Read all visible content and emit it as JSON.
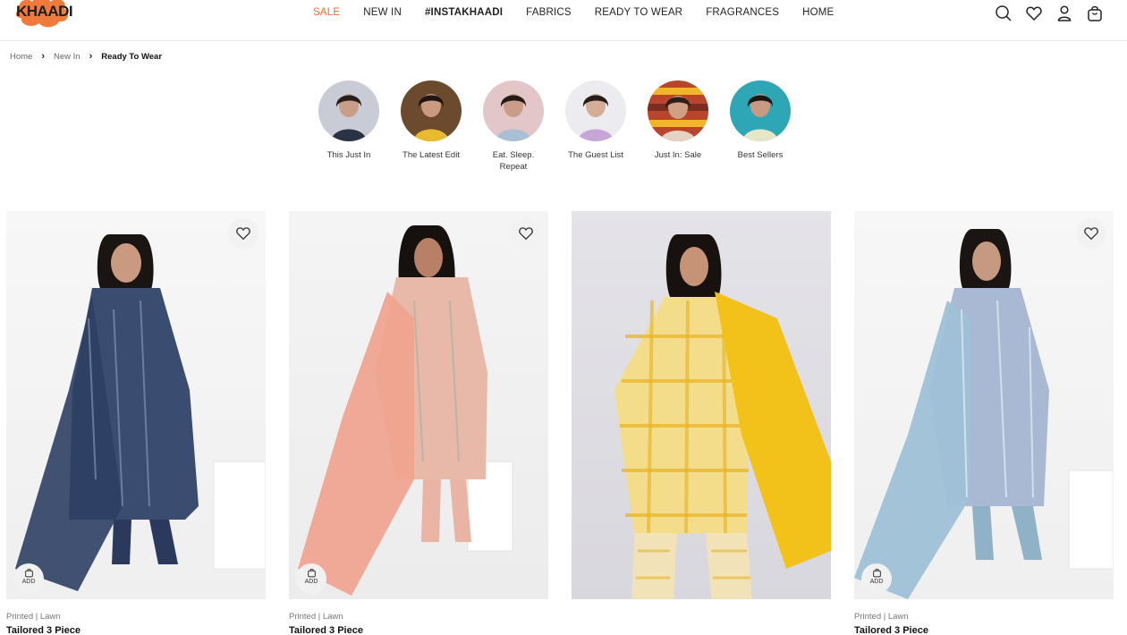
{
  "brand": {
    "logo_text": "KHAADI",
    "accent_color": "#ee6e2d",
    "logo_blob_color": "#ef7a3b"
  },
  "nav": {
    "items": [
      {
        "label": "SALE"
      },
      {
        "label": "NEW IN"
      },
      {
        "label": "#INSTAKHAADI"
      },
      {
        "label": "FABRICS"
      },
      {
        "label": "READY TO WEAR"
      },
      {
        "label": "FRAGRANCES"
      },
      {
        "label": "HOME"
      }
    ]
  },
  "header_icons": [
    "search-icon",
    "heart-icon",
    "user-icon",
    "bag-icon"
  ],
  "breadcrumb": {
    "items": [
      "Home",
      "New In",
      "Ready To Wear"
    ]
  },
  "categories": [
    {
      "label": "This Just In",
      "bg": "#c9ccd6"
    },
    {
      "label": "The Latest Edit",
      "bg": "#6b4a2e"
    },
    {
      "label": "Eat. Sleep. Repeat",
      "bg": "#e3c6c8"
    },
    {
      "label": "The Guest List",
      "bg": "#ecebef"
    },
    {
      "label": "Just In: Sale",
      "bg": "#b8452c"
    },
    {
      "label": "Best Sellers",
      "bg": "#2fa6b6"
    }
  ],
  "products": [
    {
      "sub": "Printed | Lawn",
      "name": "Tailored 3 Piece",
      "add": "ADD",
      "dress": "#3a4c70",
      "dupatta": "#2e3f63",
      "pants": "#2b3a5c"
    },
    {
      "sub": "Printed | Lawn",
      "name": "Tailored 3 Piece",
      "add": "ADD",
      "dress": "#e8b8a8",
      "dupatta": "#f0a38f",
      "pants": "#eab4a4"
    },
    {
      "sub": "",
      "name": "",
      "add": "",
      "dress": "#f3dd8a",
      "dupatta": "#f2c21b",
      "pants": "#f1e3b7"
    },
    {
      "sub": "Printed | Lawn",
      "name": "Tailored 3 Piece",
      "add": "ADD",
      "dress": "#a9b9d3",
      "dupatta": "#9ec0d6",
      "pants": "#8fb2c7"
    }
  ]
}
